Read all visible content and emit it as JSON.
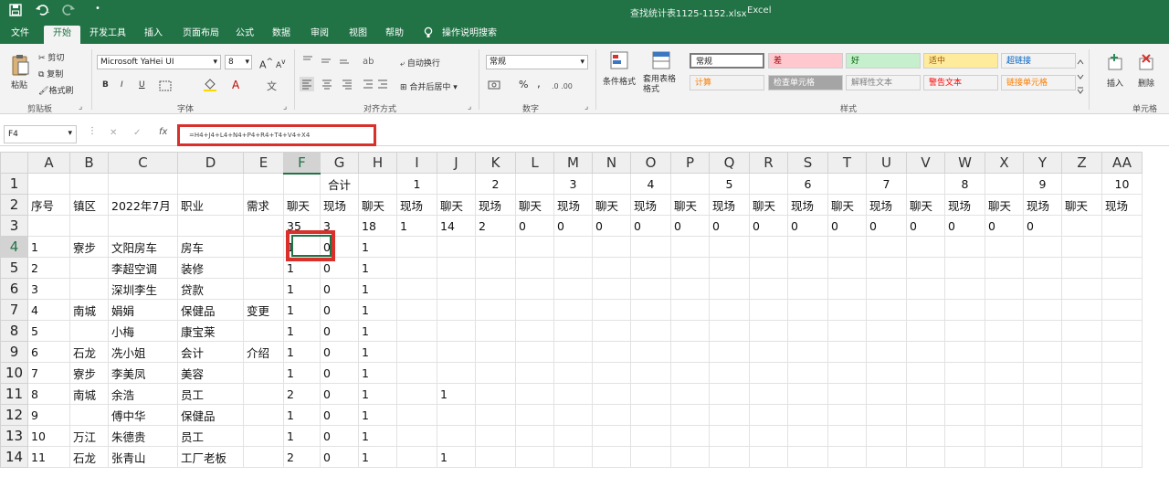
{
  "window": {
    "title": "查找统计表1125-1152.xlsx",
    "app": "Excel",
    "quick_access": {
      "save_icon": "save-icon",
      "undo_icon": "undo-icon",
      "redo_icon": "redo-icon",
      "customize": "•"
    }
  },
  "tabs": [
    "文件",
    "开始",
    "开发工具",
    "插入",
    "页面布局",
    "公式",
    "数据",
    "审阅",
    "视图",
    "帮助",
    "操作说明搜索"
  ],
  "active_tab": "开始",
  "ribbon": {
    "clipboard": {
      "paste": "粘贴",
      "cut": "剪切",
      "copy": "复制",
      "format_painter": "格式刷",
      "label": "剪贴板"
    },
    "font": {
      "name": "Microsoft YaHei UI",
      "size": "8",
      "label": "字体",
      "bold": "B",
      "italic": "I",
      "underline": "U",
      "grow": "A",
      "shrink": "A",
      "color": "A"
    },
    "alignment": {
      "wrap": "自动换行",
      "merge": "合并后居中",
      "label": "对齐方式"
    },
    "number": {
      "format": "常规",
      "percent": "%",
      "comma": ",",
      "label": "数字"
    },
    "styles": {
      "conditional": "条件格式",
      "table": "套用表格格式",
      "label": "样式",
      "cells": [
        {
          "text": "常规",
          "bg": "#ffffff",
          "color": "#222"
        },
        {
          "text": "差",
          "bg": "#ffc7ce",
          "color": "#9c0006"
        },
        {
          "text": "好",
          "bg": "#c6efce",
          "color": "#006100"
        },
        {
          "text": "适中",
          "bg": "#ffeb9c",
          "color": "#9c5700"
        },
        {
          "text": "超链接",
          "bg": "#f3f3f3",
          "color": "#0563c1"
        },
        {
          "text": "计算",
          "bg": "#f2f2f2",
          "color": "#fa7d00"
        },
        {
          "text": "检查单元格",
          "bg": "#a5a5a5",
          "color": "#ffffff"
        },
        {
          "text": "解释性文本",
          "bg": "#f3f3f3",
          "color": "#7f7f7f"
        },
        {
          "text": "警告文本",
          "bg": "#f3f3f3",
          "color": "#ff0000"
        },
        {
          "text": "链接单元格",
          "bg": "#f3f3f3",
          "color": "#fa7d00"
        }
      ]
    },
    "cells_group": {
      "insert": "插入",
      "delete": "删除",
      "label": "单元格"
    }
  },
  "formula_bar": {
    "name_box": "F4",
    "cancel": "✕",
    "confirm": "✓",
    "fx": "fx",
    "formula": "=H4+J4+L4+N4+P4+R4+T4+V4+X4"
  },
  "grid": {
    "columns": [
      "A",
      "B",
      "C",
      "D",
      "E",
      "F",
      "G",
      "H",
      "I",
      "J",
      "K",
      "L",
      "M",
      "N",
      "O",
      "P",
      "Q",
      "R",
      "S",
      "T",
      "U",
      "V",
      "W",
      "X",
      "Y",
      "Z",
      "AA"
    ],
    "active_column": "F",
    "active_row": 4,
    "rows": [
      {
        "n": "1",
        "cells": [
          "",
          "",
          "",
          "",
          "",
          "",
          "合计",
          "",
          "1",
          "",
          "2",
          "",
          "3",
          "",
          "4",
          "",
          "5",
          "",
          "6",
          "",
          "7",
          "",
          "8",
          "",
          "9",
          "",
          "10"
        ]
      },
      {
        "n": "2",
        "cells": [
          "序号",
          "镇区",
          "2022年7月",
          "职业",
          "需求",
          "聊天",
          "现场",
          "聊天",
          "现场",
          "聊天",
          "现场",
          "聊天",
          "现场",
          "聊天",
          "现场",
          "聊天",
          "现场",
          "聊天",
          "现场",
          "聊天",
          "现场",
          "聊天",
          "现场",
          "聊天",
          "现场",
          "聊天",
          "现场"
        ]
      },
      {
        "n": "3",
        "cells": [
          "",
          "",
          "",
          "",
          "",
          "35",
          "3",
          "18",
          "1",
          "14",
          "2",
          "0",
          "0",
          "0",
          "0",
          "0",
          "0",
          "0",
          "0",
          "0",
          "0",
          "0",
          "0",
          "0",
          "0",
          "",
          ""
        ]
      },
      {
        "n": "4",
        "cells": [
          "1",
          "寮步",
          "文阳房车",
          "房车",
          "",
          "1",
          "0",
          "1",
          "",
          "",
          "",
          "",
          "",
          "",
          "",
          "",
          "",
          "",
          "",
          "",
          "",
          "",
          "",
          "",
          "",
          "",
          ""
        ]
      },
      {
        "n": "5",
        "cells": [
          "2",
          "",
          "李超空调",
          "装修",
          "",
          "1",
          "0",
          "1",
          "",
          "",
          "",
          "",
          "",
          "",
          "",
          "",
          "",
          "",
          "",
          "",
          "",
          "",
          "",
          "",
          "",
          "",
          ""
        ]
      },
      {
        "n": "6",
        "cells": [
          "3",
          "",
          "深圳李生",
          "贷款",
          "",
          "1",
          "0",
          "1",
          "",
          "",
          "",
          "",
          "",
          "",
          "",
          "",
          "",
          "",
          "",
          "",
          "",
          "",
          "",
          "",
          "",
          "",
          ""
        ]
      },
      {
        "n": "7",
        "cells": [
          "4",
          "南城",
          "娟娟",
          "保健品",
          "变更",
          "1",
          "0",
          "1",
          "",
          "",
          "",
          "",
          "",
          "",
          "",
          "",
          "",
          "",
          "",
          "",
          "",
          "",
          "",
          "",
          "",
          "",
          ""
        ]
      },
      {
        "n": "8",
        "cells": [
          "5",
          "",
          "小梅",
          "康宝莱",
          "",
          "1",
          "0",
          "1",
          "",
          "",
          "",
          "",
          "",
          "",
          "",
          "",
          "",
          "",
          "",
          "",
          "",
          "",
          "",
          "",
          "",
          "",
          ""
        ]
      },
      {
        "n": "9",
        "cells": [
          "6",
          "石龙",
          "冼小姐",
          "会计",
          "介绍",
          "1",
          "0",
          "1",
          "",
          "",
          "",
          "",
          "",
          "",
          "",
          "",
          "",
          "",
          "",
          "",
          "",
          "",
          "",
          "",
          "",
          "",
          ""
        ]
      },
      {
        "n": "10",
        "cells": [
          "7",
          "寮步",
          "李美凤",
          "美容",
          "",
          "1",
          "0",
          "1",
          "",
          "",
          "",
          "",
          "",
          "",
          "",
          "",
          "",
          "",
          "",
          "",
          "",
          "",
          "",
          "",
          "",
          "",
          ""
        ]
      },
      {
        "n": "11",
        "cells": [
          "8",
          "南城",
          "余浩",
          "员工",
          "",
          "2",
          "0",
          "1",
          "",
          "1",
          "",
          "",
          "",
          "",
          "",
          "",
          "",
          "",
          "",
          "",
          "",
          "",
          "",
          "",
          "",
          "",
          ""
        ]
      },
      {
        "n": "12",
        "cells": [
          "9",
          "",
          "傅中华",
          "保健品",
          "",
          "1",
          "0",
          "1",
          "",
          "",
          "",
          "",
          "",
          "",
          "",
          "",
          "",
          "",
          "",
          "",
          "",
          "",
          "",
          "",
          "",
          "",
          ""
        ]
      },
      {
        "n": "13",
        "cells": [
          "10",
          "万江",
          "朱德贵",
          "员工",
          "",
          "1",
          "0",
          "1",
          "",
          "",
          "",
          "",
          "",
          "",
          "",
          "",
          "",
          "",
          "",
          "",
          "",
          "",
          "",
          "",
          "",
          "",
          ""
        ]
      },
      {
        "n": "14",
        "cells": [
          "11",
          "石龙",
          "张青山",
          "工厂老板",
          "",
          "2",
          "0",
          "1",
          "",
          "1",
          "",
          "",
          "",
          "",
          "",
          "",
          "",
          "",
          "",
          "",
          "",
          "",
          "",
          "",
          "",
          "",
          ""
        ]
      }
    ]
  }
}
